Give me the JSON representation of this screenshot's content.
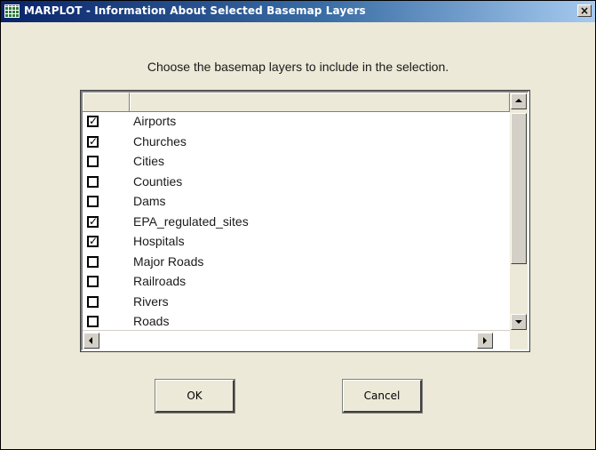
{
  "window": {
    "title": "MARPLOT - Information About Selected Basemap Layers",
    "close_glyph": "×"
  },
  "instruction": "Choose the basemap layers to include in the selection.",
  "layers": [
    {
      "name": "Airports",
      "checked": true
    },
    {
      "name": "Churches",
      "checked": true
    },
    {
      "name": "Cities",
      "checked": false
    },
    {
      "name": "Counties",
      "checked": false
    },
    {
      "name": "Dams",
      "checked": false
    },
    {
      "name": "EPA_regulated_sites",
      "checked": true
    },
    {
      "name": "Hospitals",
      "checked": true
    },
    {
      "name": "Major Roads",
      "checked": false
    },
    {
      "name": "Railroads",
      "checked": false
    },
    {
      "name": "Rivers",
      "checked": false
    },
    {
      "name": "Roads",
      "checked": false
    }
  ],
  "buttons": {
    "ok": "OK",
    "cancel": "Cancel"
  },
  "check_glyph": "✓",
  "icons": {
    "app": "marplot-grid-icon",
    "close": "close-icon"
  }
}
